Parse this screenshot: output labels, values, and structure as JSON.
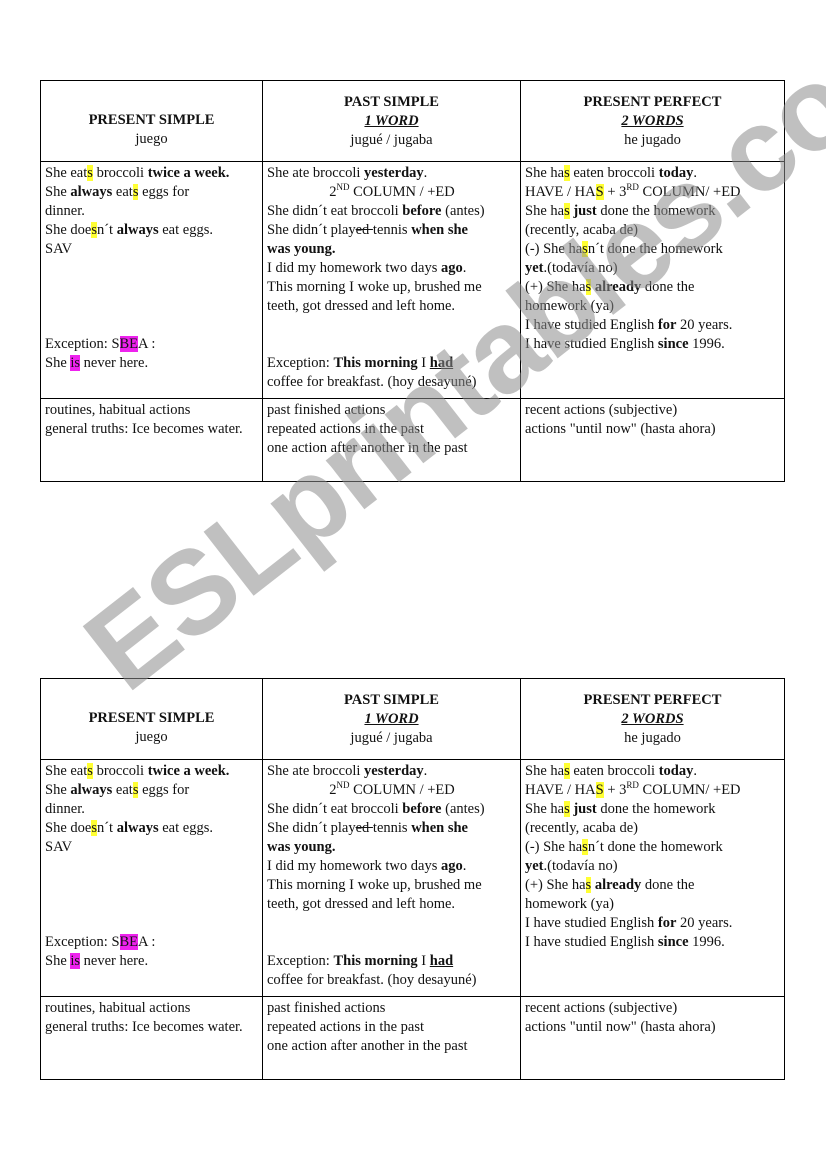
{
  "watermark": "ESLprintables.com",
  "colors": {
    "highlight_yellow": "#ffff33",
    "highlight_magenta": "#ee22ee",
    "border": "#000000"
  },
  "table": {
    "headers": [
      {
        "title": "PRESENT SIMPLE",
        "subtitle": "",
        "translation": "juego"
      },
      {
        "title": "PAST SIMPLE",
        "subtitle": "1 WORD",
        "translation": "jugué / jugaba"
      },
      {
        "title": "PRESENT PERFECT",
        "subtitle": "2 WORDS",
        "translation": "he jugado"
      }
    ],
    "present_simple": {
      "l1": {
        "a": "She eat",
        "hl": "s",
        "b": " broccoli ",
        "bold": "twice a week."
      },
      "l2": {
        "a": "She ",
        "bold": "always",
        "b": " eat",
        "hl": "s",
        "c": " eggs for"
      },
      "l3": "dinner.",
      "l4": {
        "a": "She doe",
        "hl": "s",
        "b": "n´t ",
        "bold": "always",
        "c": " eat eggs."
      },
      "l5": "SAV",
      "exception": {
        "a": "Exception: S",
        "hl": "BE",
        "b": "A :"
      },
      "exception2": {
        "a": "She ",
        "hl": "is",
        "b": " never here."
      }
    },
    "past_simple": {
      "l1": {
        "a": "She ate broccoli ",
        "bold": "yesterday",
        "b": "."
      },
      "l2": {
        "num": "2",
        "sup": "ND",
        "rest": " COLUMN / +ED"
      },
      "l3": {
        "a": "She didn´t eat broccoli ",
        "bold": "before",
        "b": " (antes)"
      },
      "l4": {
        "a": "She didn´t play",
        "strike": "ed ",
        "b": "tennis ",
        "bold": "when she"
      },
      "l5": {
        "bold": "was young."
      },
      "l6": {
        "a": "I did my homework two days ",
        "bold": "ago",
        "b": "."
      },
      "l7": "This morning I woke up, brushed me",
      "l8": "teeth, got dressed and left home.",
      "exception": {
        "a": "Exception: ",
        "bold": "This morning",
        "b": " I ",
        "boldul": "had"
      },
      "exception2": "coffee for breakfast. (hoy desayuné)"
    },
    "present_perfect": {
      "l1": {
        "a": "She ha",
        "hl": "s",
        "b": " eaten broccoli ",
        "bold": "today",
        "c": "."
      },
      "l2": {
        "a": "HAVE / HA",
        "hl": "S",
        "b": " + 3",
        "sup": "RD",
        "c": " COLUMN/ +ED"
      },
      "l3": {
        "a": "She ha",
        "hl": "s",
        "b": " ",
        "bold": "just",
        "c": " done the homework"
      },
      "l4": "(recently, acaba de)",
      "l5": {
        "a": "(-) She ha",
        "hl": "s",
        "b": "n´t done the homework"
      },
      "l6": {
        "bold": "yet",
        "a": ".(todavía no)"
      },
      "l7": {
        "a": "(+) She ha",
        "hl": "s",
        "b": " ",
        "bold": "already",
        "c": " done the"
      },
      "l8": "homework (ya)",
      "l9": {
        "a": "I have studied English ",
        "bold": "for",
        "b": " 20 years."
      },
      "l10": {
        "a": "I have studied English ",
        "bold": "since",
        "b": " 1996."
      }
    },
    "uses": [
      [
        "routines, habitual actions",
        "general truths: Ice becomes water."
      ],
      [
        "past finished actions",
        "repeated actions in the past",
        "one action after another in the past"
      ],
      [
        "recent actions (subjective)",
        "actions \"until now\" (hasta ahora)"
      ]
    ]
  }
}
